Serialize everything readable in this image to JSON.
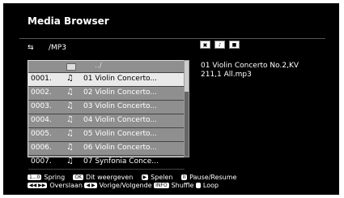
{
  "app": {
    "title": "Media Browser"
  },
  "path": {
    "icon": "usb-icon",
    "label": "/MP3"
  },
  "mode_icons": [
    "photo-icon",
    "music-icon",
    "video-icon"
  ],
  "list": {
    "up_label": "../",
    "items": [
      {
        "num": "0001.",
        "name": "01 Violin Concerto...",
        "selected": true
      },
      {
        "num": "0002.",
        "name": "02 Violin Concerto...",
        "selected": false
      },
      {
        "num": "0003.",
        "name": "03 Violin Concerto...",
        "selected": false
      },
      {
        "num": "0004.",
        "name": "04 Violin Concerto...",
        "selected": false
      },
      {
        "num": "0005.",
        "name": "05 Violin Concerto...",
        "selected": false
      },
      {
        "num": "0006.",
        "name": "06 Violin Concerto...",
        "selected": false
      },
      {
        "num": "0007.",
        "name": "07 Synfonia Conce...",
        "selected": false
      }
    ]
  },
  "detail": {
    "line1": "01 Violin Concerto No.2,KV",
    "line2": "211,1 All.mp3"
  },
  "footer": {
    "jump_key": "1...0",
    "jump_label": "Spring",
    "ok_key": "OK",
    "ok_label": "Dit weergeven",
    "play_key": "▶",
    "play_label": "Spelen",
    "pause_key": "II",
    "pause_label": "Pause/Resume",
    "skip_key": "◀◀ ▶▶",
    "skip_label": "Overslaan",
    "prevnext_key": "◀ ▶",
    "prevnext_label": "Vorige/Volgende",
    "info_key": "INFO",
    "info_label": "Shuffle",
    "loop_key": "",
    "loop_label": "Loop"
  }
}
